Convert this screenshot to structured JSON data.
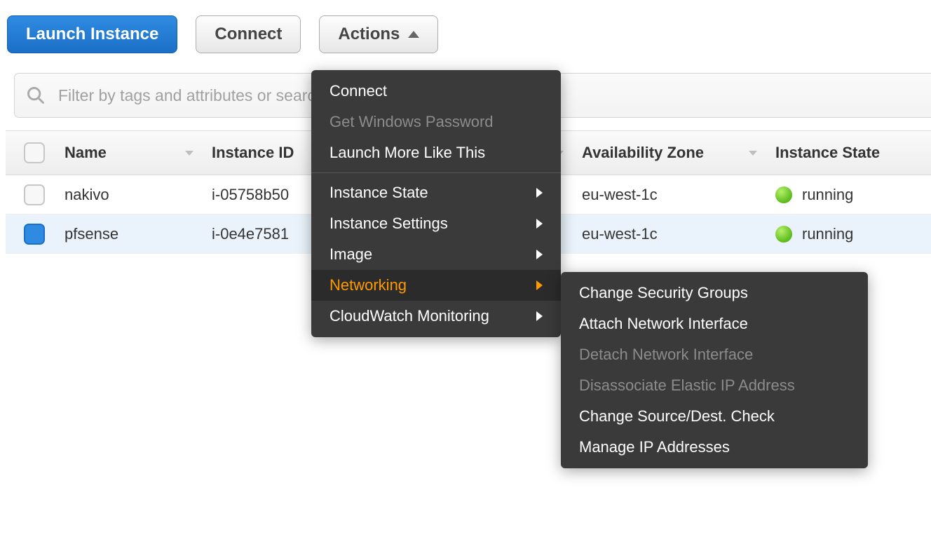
{
  "toolbar": {
    "launch_label": "Launch Instance",
    "connect_label": "Connect",
    "actions_label": "Actions"
  },
  "search": {
    "placeholder": "Filter by tags and attributes or search by keyword"
  },
  "columns": {
    "name": "Name",
    "instance_id": "Instance ID",
    "availability_zone": "Availability Zone",
    "instance_state": "Instance State"
  },
  "rows": [
    {
      "name": "nakivo",
      "instance_id": "i-05758b50",
      "az": "eu-west-1c",
      "state": "running"
    },
    {
      "name": "pfsense",
      "instance_id": "i-0e4e7581",
      "az": "eu-west-1c",
      "state": "running"
    }
  ],
  "actions_menu": {
    "connect": "Connect",
    "get_windows_password": "Get Windows Password",
    "launch_more": "Launch More Like This",
    "instance_state": "Instance State",
    "instance_settings": "Instance Settings",
    "image": "Image",
    "networking": "Networking",
    "cloudwatch": "CloudWatch Monitoring"
  },
  "networking_submenu": {
    "change_sg": "Change Security Groups",
    "attach_eni": "Attach Network Interface",
    "detach_eni": "Detach Network Interface",
    "disassoc_eip": "Disassociate Elastic IP Address",
    "source_dest": "Change Source/Dest. Check",
    "manage_ip": "Manage IP Addresses"
  }
}
